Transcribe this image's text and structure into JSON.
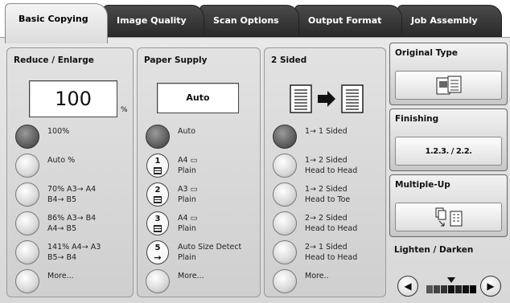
{
  "tabs": [
    {
      "label": "Basic Copying",
      "active": true
    },
    {
      "label": "Image Quality",
      "active": false
    },
    {
      "label": "Scan Options",
      "active": false
    },
    {
      "label": "Output Format",
      "active": false
    },
    {
      "label": "Job Assembly",
      "active": false
    }
  ],
  "reduce": {
    "title": "Reduce / Enlarge",
    "value": "100",
    "unit": "%",
    "options": [
      {
        "line1": "100%",
        "line2": "",
        "selected": true
      },
      {
        "line1": "Auto %",
        "line2": "",
        "selected": false
      },
      {
        "line1": "70% A3→ A4",
        "line2": "B4→ B5",
        "selected": false
      },
      {
        "line1": "86% A3→ B4",
        "line2": "A4→ B5",
        "selected": false
      },
      {
        "line1": "141% A4→ A3",
        "line2": "B5→ B4",
        "selected": false
      },
      {
        "line1": "More...",
        "line2": "",
        "selected": false
      }
    ]
  },
  "paper": {
    "title": "Paper Supply",
    "value": "Auto",
    "options": [
      {
        "icon": "",
        "line1": "Auto",
        "line2": "",
        "selected": true
      },
      {
        "icon": "1",
        "line1": "A4",
        "line2": "Plain",
        "selected": false
      },
      {
        "icon": "2",
        "line1": "A3",
        "line2": "Plain",
        "selected": false
      },
      {
        "icon": "3",
        "line1": "A4",
        "line2": "Plain",
        "selected": false
      },
      {
        "icon": "5",
        "line1": "Auto Size Detect",
        "line2": "Plain",
        "selected": false
      },
      {
        "icon": "",
        "line1": "More...",
        "line2": "",
        "selected": false
      }
    ]
  },
  "sided": {
    "title": "2 Sided",
    "options": [
      {
        "line1": "1→ 1 Sided",
        "line2": "",
        "selected": true
      },
      {
        "line1": "1→ 2 Sided",
        "line2": "Head to Head",
        "selected": false
      },
      {
        "line1": "1→ 2 Sided",
        "line2": "Head to Toe",
        "selected": false
      },
      {
        "line1": "2→ 2 Sided",
        "line2": "Head to Head",
        "selected": false
      },
      {
        "line1": "2→ 1 Sided",
        "line2": "Head to Head",
        "selected": false
      },
      {
        "line1": "More..",
        "line2": "",
        "selected": false
      }
    ]
  },
  "right": {
    "original_type": "Original Type",
    "finishing": "Finishing",
    "finishing_face": "1.2.3. / 2.2.",
    "multiple_up": "Multiple-Up",
    "lighten_darken": "Lighten / Darken"
  }
}
